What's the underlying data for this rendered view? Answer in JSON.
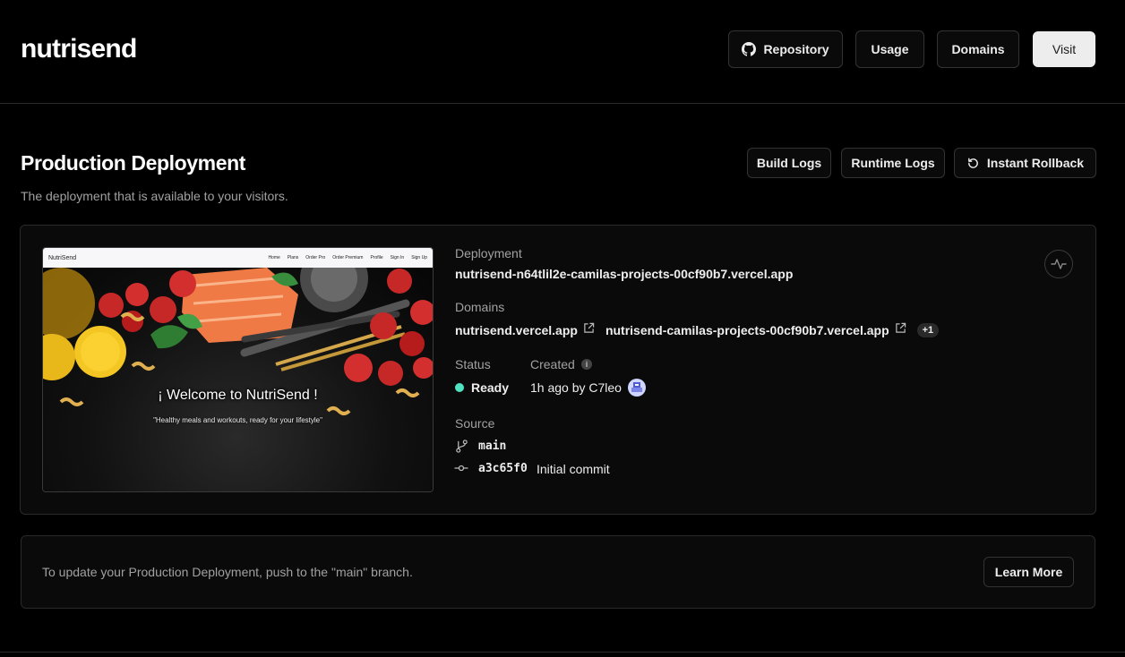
{
  "header": {
    "project_name": "nutrisend",
    "buttons": {
      "repository": "Repository",
      "usage": "Usage",
      "domains": "Domains",
      "visit": "Visit"
    }
  },
  "production": {
    "title": "Production Deployment",
    "subtitle": "The deployment that is available to your visitors.",
    "actions": {
      "build_logs": "Build Logs",
      "runtime_logs": "Runtime Logs",
      "instant_rollback": "Instant Rollback"
    },
    "preview": {
      "brand": "NutriSend",
      "nav_links": [
        "Home",
        "Plans",
        "Order Pro",
        "Order Premium",
        "Profile",
        "Sign In",
        "Sign Up"
      ],
      "welcome": "¡ Welcome to NutriSend !",
      "tagline": "\"Healthy meals and workouts, ready for your lifestyle\""
    },
    "deployment": {
      "label": "Deployment",
      "url": "nutrisend-n64tlil2e-camilas-projects-00cf90b7.vercel.app"
    },
    "domains": {
      "label": "Domains",
      "items": [
        "nutrisend.vercel.app",
        "nutrisend-camilas-projects-00cf90b7.vercel.app"
      ],
      "extra": "+1"
    },
    "status": {
      "label": "Status",
      "value": "Ready",
      "color": "#50e3c2"
    },
    "created": {
      "label": "Created",
      "value": "1h ago by C7leo"
    },
    "source": {
      "label": "Source",
      "branch": "main",
      "commit_hash": "a3c65f0",
      "commit_message": "Initial commit"
    }
  },
  "notice": {
    "text": "To update your Production Deployment, push to the \"main\" branch.",
    "button": "Learn More"
  },
  "icons": [
    "github-icon",
    "rollback-icon",
    "external-link-icon",
    "info-icon",
    "branch-icon",
    "commit-icon",
    "activity-icon"
  ]
}
